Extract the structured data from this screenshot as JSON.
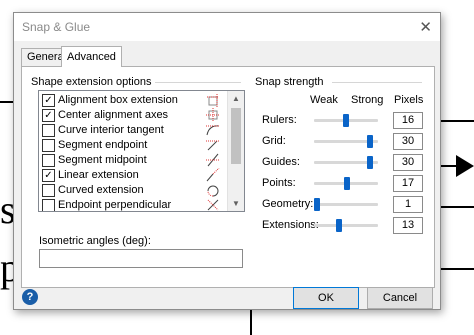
{
  "dialog": {
    "title": "Snap & Glue",
    "close_glyph": "✕"
  },
  "tabs": [
    {
      "label": "General",
      "selected": false
    },
    {
      "label": "Advanced",
      "selected": true
    }
  ],
  "shape_extension": {
    "group_label": "Shape extension options",
    "items": [
      {
        "label": "Alignment box extension",
        "checked": true,
        "icon": "alignment-box-icon"
      },
      {
        "label": "Center alignment axes",
        "checked": true,
        "icon": "center-axes-icon"
      },
      {
        "label": "Curve interior tangent",
        "checked": false,
        "icon": "curve-tangent-icon"
      },
      {
        "label": "Segment endpoint",
        "checked": false,
        "icon": "segment-endpoint-icon"
      },
      {
        "label": "Segment midpoint",
        "checked": false,
        "icon": "segment-midpoint-icon"
      },
      {
        "label": "Linear extension",
        "checked": true,
        "icon": "linear-extension-icon"
      },
      {
        "label": "Curved extension",
        "checked": false,
        "icon": "curved-extension-icon"
      },
      {
        "label": "Endpoint perpendicular",
        "checked": false,
        "icon": "endpoint-perpendicular-icon"
      }
    ],
    "check_glyph": "✓"
  },
  "isometric": {
    "label": "Isometric angles (deg):",
    "value": ""
  },
  "snap_strength": {
    "group_label": "Snap strength",
    "weak_label": "Weak",
    "strong_label": "Strong",
    "pixels_label": "Pixels",
    "rows": [
      {
        "label": "Rulers:",
        "pixels": "16",
        "level": 0.5
      },
      {
        "label": "Grid:",
        "pixels": "30",
        "level": 0.92
      },
      {
        "label": "Guides:",
        "pixels": "30",
        "level": 0.92
      },
      {
        "label": "Points:",
        "pixels": "17",
        "level": 0.52
      },
      {
        "label": "Geometry:",
        "pixels": "1",
        "level": 0.0
      },
      {
        "label": "Extensions:",
        "pixels": "13",
        "level": 0.38
      }
    ]
  },
  "footer": {
    "help_glyph": "?",
    "ok_label": "OK",
    "cancel_label": "Cancel"
  },
  "background": {
    "text_1": "s",
    "text_2": "p]"
  },
  "colors": {
    "accent": "#0a64c8",
    "ok_border": "#0078d7",
    "help_bg": "#1a5ea8"
  }
}
